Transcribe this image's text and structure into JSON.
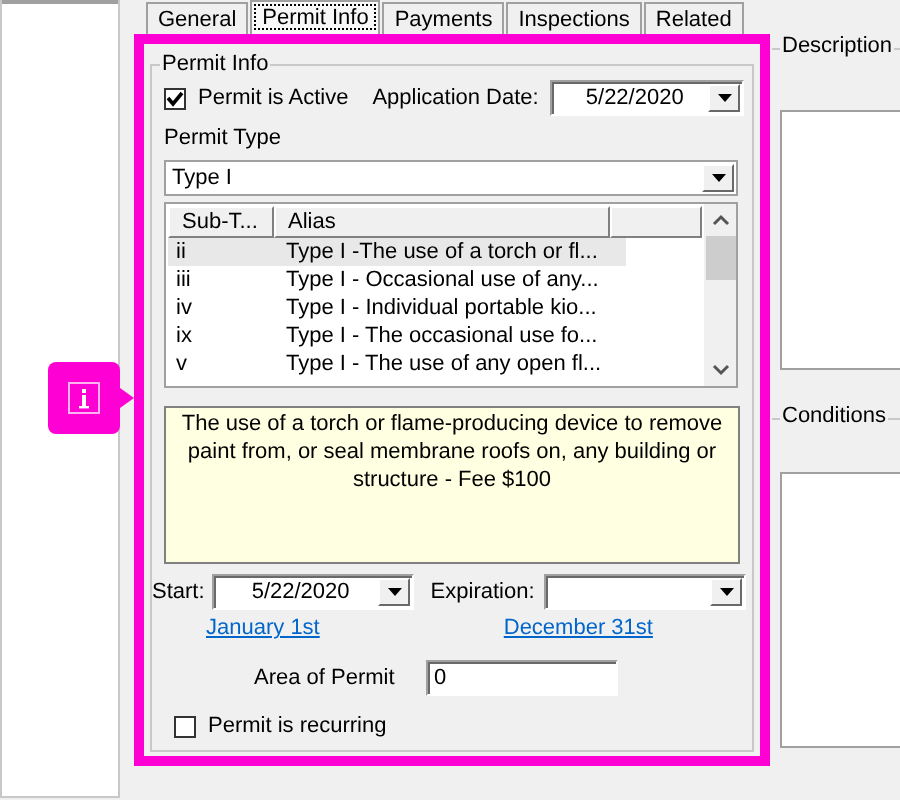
{
  "tabs": [
    {
      "label": "General",
      "selected": false
    },
    {
      "label": "Permit Info",
      "selected": true
    },
    {
      "label": "Payments",
      "selected": false
    },
    {
      "label": "Inspections",
      "selected": false
    },
    {
      "label": "Related",
      "selected": false
    }
  ],
  "permit_info": {
    "title": "Permit Info",
    "active_checkbox": {
      "label": "Permit is Active",
      "checked": true
    },
    "application_date": {
      "label": "Application Date:",
      "value": "5/22/2020"
    },
    "permit_type": {
      "label": "Permit Type",
      "value": "Type I"
    },
    "subtypes": {
      "columns": [
        "Sub-T...",
        "Alias"
      ],
      "rows": [
        {
          "sub_type": "ii",
          "alias": "Type I -The use of a torch or fl...",
          "selected": true
        },
        {
          "sub_type": "iii",
          "alias": "Type I - Occasional use of any...",
          "selected": false
        },
        {
          "sub_type": "iv",
          "alias": "Type I - Individual portable kio...",
          "selected": false
        },
        {
          "sub_type": "ix",
          "alias": "Type I - The occasional use fo...",
          "selected": false
        },
        {
          "sub_type": "v",
          "alias": "Type I - The use of any open fl...",
          "selected": false
        }
      ]
    },
    "description": "The use of a torch or flame-producing device to remove paint from, or seal membrane roofs on, any building or structure - Fee $100",
    "start": {
      "label": "Start:",
      "value": "5/22/2020",
      "link": "January 1st"
    },
    "expiration": {
      "label": "Expiration:",
      "link": "December 31st"
    },
    "area": {
      "label": "Area of Permit",
      "value": "0"
    },
    "recurring_checkbox": {
      "label": "Permit is recurring",
      "checked": false
    }
  },
  "side_groups": [
    {
      "title": "Description"
    },
    {
      "title": "Conditions"
    }
  ]
}
